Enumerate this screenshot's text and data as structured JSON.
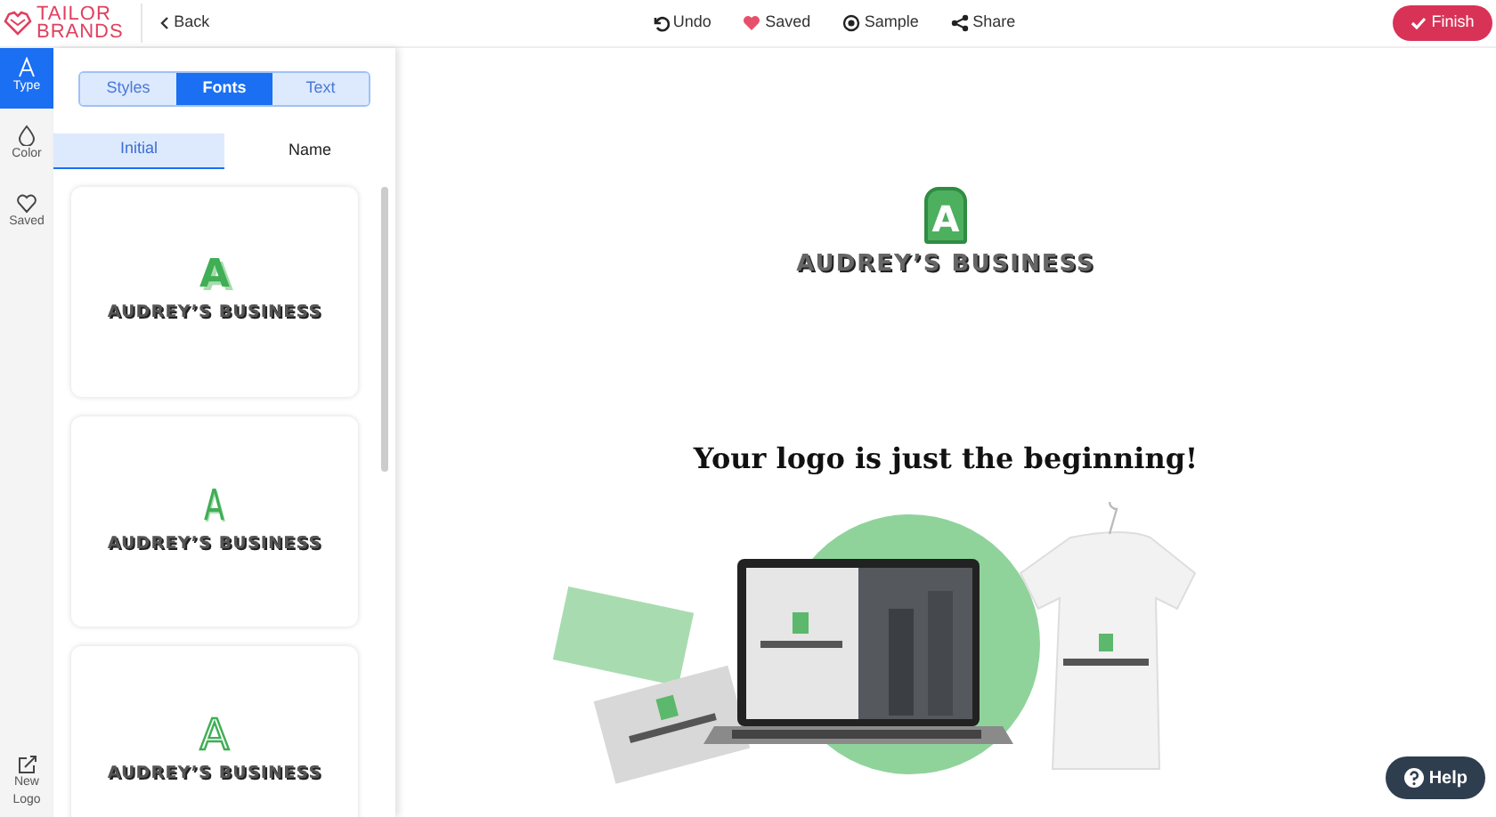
{
  "brand": {
    "line1": "TAILOR",
    "line2": "BRANDS"
  },
  "back": {
    "label": "Back"
  },
  "toolbar": [
    {
      "kind": "undo",
      "label": "Undo"
    },
    {
      "kind": "saved",
      "label": "Saved"
    },
    {
      "kind": "sample",
      "label": "Sample"
    },
    {
      "kind": "share",
      "label": "Share"
    }
  ],
  "finish": {
    "label": "Finish"
  },
  "sidebar": {
    "items": [
      {
        "kind": "type",
        "label": "Type",
        "selected": true
      },
      {
        "kind": "color",
        "label": "Color",
        "selected": false
      },
      {
        "kind": "saved",
        "label": "Saved",
        "selected": false
      }
    ],
    "new_logo": {
      "label": "New Logo"
    }
  },
  "segment_tabs": [
    {
      "label": "Styles",
      "selected": false
    },
    {
      "label": "Fonts",
      "selected": true
    },
    {
      "label": "Text",
      "selected": false
    }
  ],
  "sub_tabs": [
    {
      "label": "Initial",
      "selected": true
    },
    {
      "label": "Name",
      "selected": false
    }
  ],
  "font_cards": [
    {
      "initial": "A",
      "kind": "solid",
      "name": "AUDREY’S BUSINESS"
    },
    {
      "initial": "A",
      "kind": "thin",
      "name": "AUDREY’S BUSINESS"
    },
    {
      "initial": "A",
      "kind": "outline",
      "name": "AUDREY’S BUSINESS"
    }
  ],
  "preview": {
    "initial": "A",
    "name": "AUDREY’S BUSINESS"
  },
  "tagline": "Your logo is just the beginning!",
  "help": {
    "label": "Help"
  }
}
